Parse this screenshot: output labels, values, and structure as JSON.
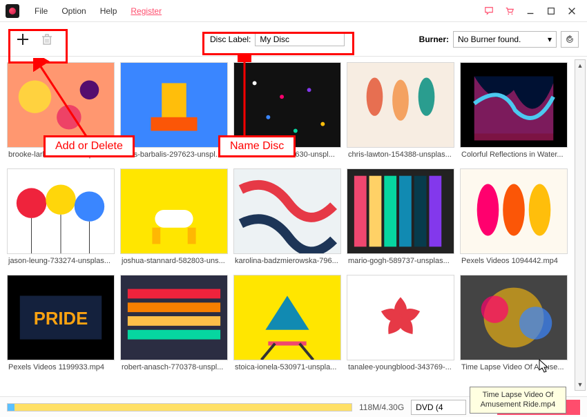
{
  "menu": {
    "file": "File",
    "option": "Option",
    "help": "Help",
    "register": "Register"
  },
  "toolbar": {
    "disc_label_label": "Disc Label:",
    "disc_label_value": "My Disc",
    "burner_label": "Burner:",
    "burner_value": "No Burner found."
  },
  "annotations": {
    "add_delete": "Add or Delete",
    "name_disc": "Name Disc"
  },
  "thumbs": [
    {
      "label": "brooke-lark-235088-unsplas..."
    },
    {
      "label": "chris-barbalis-297623-unspl..."
    },
    {
      "label": "chris-barbalis-627630-unspl..."
    },
    {
      "label": "chris-lawton-154388-unsplas..."
    },
    {
      "label": "Colorful Reflections in Water..."
    },
    {
      "label": "jason-leung-733274-unsplas..."
    },
    {
      "label": "joshua-stannard-582803-uns..."
    },
    {
      "label": "karolina-badzmierowska-796..."
    },
    {
      "label": "mario-gogh-589737-unsplas..."
    },
    {
      "label": "Pexels Videos 1094442.mp4"
    },
    {
      "label": "Pexels Videos 1199933.mp4"
    },
    {
      "label": "robert-anasch-770378-unspl..."
    },
    {
      "label": "stoica-ionela-530971-unspla..."
    },
    {
      "label": "tanalee-youngblood-343769-..."
    },
    {
      "label": "Time Lapse Video Of Amuse..."
    }
  ],
  "status": {
    "size": "118M/4.30G",
    "format": "DVD (4"
  },
  "tooltip": "Time Lapse Video Of\nAmusement Ride.mp4"
}
